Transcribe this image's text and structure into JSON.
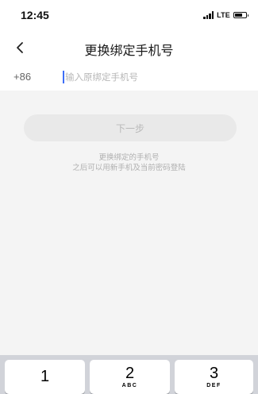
{
  "status_bar": {
    "time": "12:45",
    "network": "LTE",
    "battery_level": 0.72
  },
  "nav": {
    "title": "更换绑定手机号",
    "back_icon": "chevron-left-icon"
  },
  "phone_form": {
    "country_code": "+86",
    "input_value": "",
    "input_placeholder": "输入原绑定手机号"
  },
  "next_button": {
    "label": "下一步"
  },
  "hint": {
    "line1": "更换绑定的手机号",
    "line2": "之后可以用新手机及当前密码登陆"
  },
  "keypad": {
    "keys": [
      {
        "digit": "1",
        "letters": ""
      },
      {
        "digit": "2",
        "letters": "ABC"
      },
      {
        "digit": "3",
        "letters": "DEF"
      }
    ]
  },
  "colors": {
    "cursor": "#3d6ef7",
    "page_background": "#f4f4f4",
    "button_disabled_bg": "#e9e9e9",
    "button_disabled_text": "#b9b9b9",
    "keypad_background": "#d1d3d9"
  }
}
